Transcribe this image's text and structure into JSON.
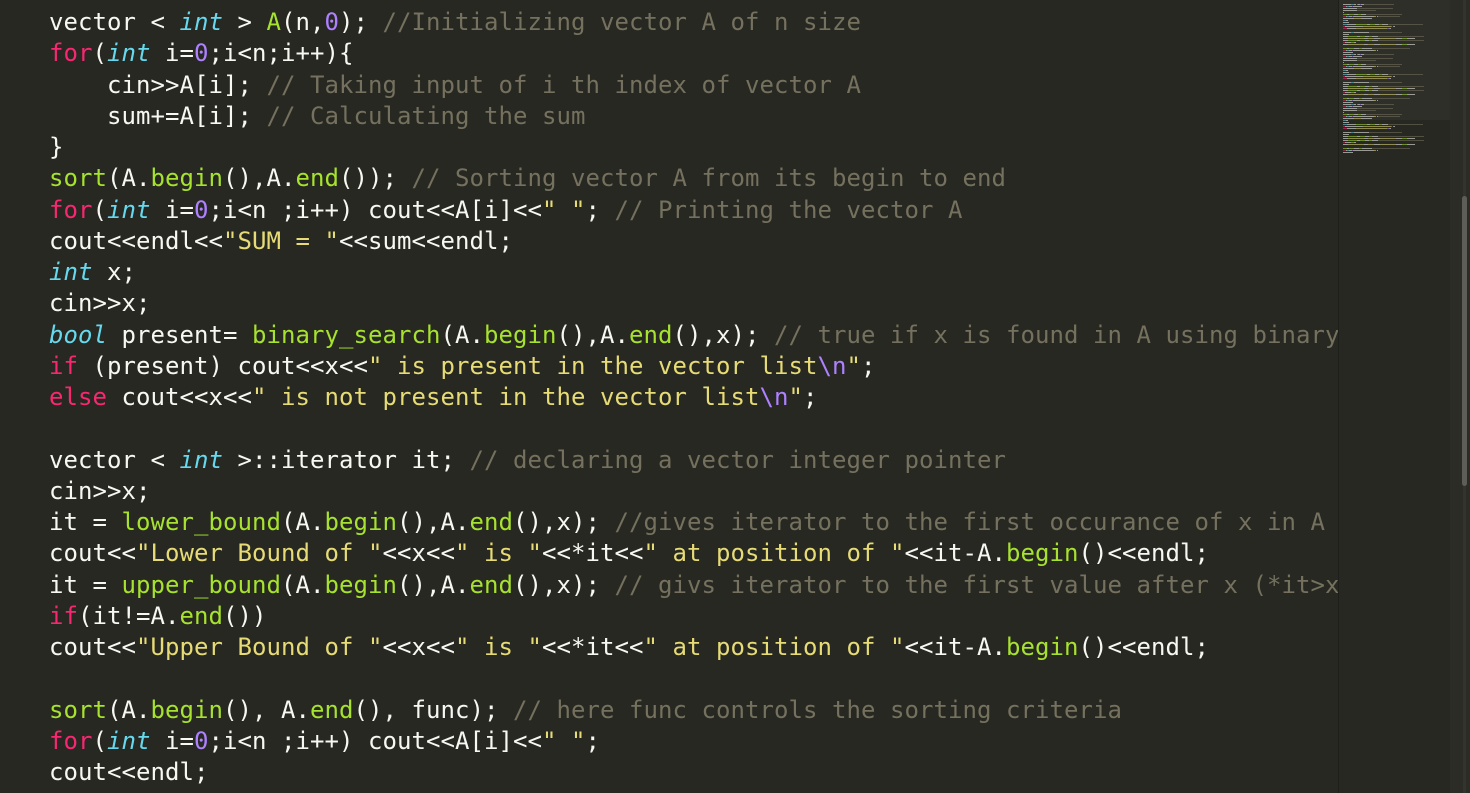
{
  "editor": {
    "colors": {
      "background": "#272822",
      "keyword": "#F92672",
      "type": "#66D9EF",
      "function": "#A6E22E",
      "string": "#E6DB74",
      "number": "#AE81FF",
      "comment": "#75715E",
      "plain": "#F8F8F2"
    },
    "lines": [
      [
        [
          "plain",
          "vector < "
        ],
        [
          "type",
          "int"
        ],
        [
          "plain",
          " > "
        ],
        [
          "fn",
          "A"
        ],
        [
          "plain",
          "(n,"
        ],
        [
          "num",
          "0"
        ],
        [
          "plain",
          "); "
        ],
        [
          "cmt",
          "//Initializing vector A of n size"
        ]
      ],
      [
        [
          "kw",
          "for"
        ],
        [
          "plain",
          "("
        ],
        [
          "type",
          "int"
        ],
        [
          "plain",
          " i="
        ],
        [
          "num",
          "0"
        ],
        [
          "plain",
          ";i<n;i++){"
        ]
      ],
      [
        [
          "plain",
          "    cin>>A[i]; "
        ],
        [
          "cmt",
          "// Taking input of i th index of vector A"
        ]
      ],
      [
        [
          "plain",
          "    sum+=A[i]; "
        ],
        [
          "cmt",
          "// Calculating the sum"
        ]
      ],
      [
        [
          "plain",
          "}"
        ]
      ],
      [
        [
          "fn",
          "sort"
        ],
        [
          "plain",
          "(A."
        ],
        [
          "fn",
          "begin"
        ],
        [
          "plain",
          "(),A."
        ],
        [
          "fn",
          "end"
        ],
        [
          "plain",
          "()); "
        ],
        [
          "cmt",
          "// Sorting vector A from its begin to end"
        ]
      ],
      [
        [
          "kw",
          "for"
        ],
        [
          "plain",
          "("
        ],
        [
          "type",
          "int"
        ],
        [
          "plain",
          " i="
        ],
        [
          "num",
          "0"
        ],
        [
          "plain",
          ";i<n ;i++) cout<<A[i]<<"
        ],
        [
          "str",
          "\" \""
        ],
        [
          "plain",
          "; "
        ],
        [
          "cmt",
          "// Printing the vector A"
        ]
      ],
      [
        [
          "plain",
          "cout<<endl<<"
        ],
        [
          "str",
          "\"SUM = \""
        ],
        [
          "plain",
          "<<sum<<endl;"
        ]
      ],
      [
        [
          "type",
          "int"
        ],
        [
          "plain",
          " x;"
        ]
      ],
      [
        [
          "plain",
          "cin>>x;"
        ]
      ],
      [
        [
          "type",
          "bool"
        ],
        [
          "plain",
          " present= "
        ],
        [
          "fn",
          "binary_search"
        ],
        [
          "plain",
          "(A."
        ],
        [
          "fn",
          "begin"
        ],
        [
          "plain",
          "(),A."
        ],
        [
          "fn",
          "end"
        ],
        [
          "plain",
          "(),x); "
        ],
        [
          "cmt",
          "// true if x is found in A using binary"
        ]
      ],
      [
        [
          "kw",
          "if"
        ],
        [
          "plain",
          " (present) cout<<x<<"
        ],
        [
          "str",
          "\" is present in the vector list"
        ],
        [
          "esc",
          "\\n"
        ],
        [
          "str",
          "\""
        ],
        [
          "plain",
          ";"
        ]
      ],
      [
        [
          "kw",
          "else"
        ],
        [
          "plain",
          " cout<<x<<"
        ],
        [
          "str",
          "\" is not present in the vector list"
        ],
        [
          "esc",
          "\\n"
        ],
        [
          "str",
          "\""
        ],
        [
          "plain",
          ";"
        ]
      ],
      [],
      [
        [
          "plain",
          "vector < "
        ],
        [
          "type",
          "int"
        ],
        [
          "plain",
          " >::iterator it; "
        ],
        [
          "cmt",
          "// declaring a vector integer pointer"
        ]
      ],
      [
        [
          "plain",
          "cin>>x;"
        ]
      ],
      [
        [
          "plain",
          "it = "
        ],
        [
          "fn",
          "lower_bound"
        ],
        [
          "plain",
          "(A."
        ],
        [
          "fn",
          "begin"
        ],
        [
          "plain",
          "(),A."
        ],
        [
          "fn",
          "end"
        ],
        [
          "plain",
          "(),x); "
        ],
        [
          "cmt",
          "//gives iterator to the first occurance of x in A ("
        ]
      ],
      [
        [
          "plain",
          "cout<<"
        ],
        [
          "str",
          "\"Lower Bound of \""
        ],
        [
          "plain",
          "<<x<<"
        ],
        [
          "str",
          "\" is \""
        ],
        [
          "plain",
          "<<*it<<"
        ],
        [
          "str",
          "\" at position of \""
        ],
        [
          "plain",
          "<<it-A."
        ],
        [
          "fn",
          "begin"
        ],
        [
          "plain",
          "()<<endl;"
        ]
      ],
      [
        [
          "plain",
          "it = "
        ],
        [
          "fn",
          "upper_bound"
        ],
        [
          "plain",
          "(A."
        ],
        [
          "fn",
          "begin"
        ],
        [
          "plain",
          "(),A."
        ],
        [
          "fn",
          "end"
        ],
        [
          "plain",
          "(),x); "
        ],
        [
          "cmt",
          "// givs iterator to the first value after x (*it>x)"
        ]
      ],
      [
        [
          "kw",
          "if"
        ],
        [
          "plain",
          "(it!=A."
        ],
        [
          "fn",
          "end"
        ],
        [
          "plain",
          "())"
        ]
      ],
      [
        [
          "plain",
          "cout<<"
        ],
        [
          "str",
          "\"Upper Bound of \""
        ],
        [
          "plain",
          "<<x<<"
        ],
        [
          "str",
          "\" is \""
        ],
        [
          "plain",
          "<<*it<<"
        ],
        [
          "str",
          "\" at position of \""
        ],
        [
          "plain",
          "<<it-A."
        ],
        [
          "fn",
          "begin"
        ],
        [
          "plain",
          "()<<endl;"
        ]
      ],
      [],
      [
        [
          "fn",
          "sort"
        ],
        [
          "plain",
          "(A."
        ],
        [
          "fn",
          "begin"
        ],
        [
          "plain",
          "(), A."
        ],
        [
          "fn",
          "end"
        ],
        [
          "plain",
          "(), func); "
        ],
        [
          "cmt",
          "// here func controls the sorting criteria"
        ]
      ],
      [
        [
          "kw",
          "for"
        ],
        [
          "plain",
          "("
        ],
        [
          "type",
          "int"
        ],
        [
          "plain",
          " i="
        ],
        [
          "num",
          "0"
        ],
        [
          "plain",
          ";i<n ;i++) cout<<A[i]<<"
        ],
        [
          "str",
          "\" \""
        ],
        [
          "plain",
          ";"
        ]
      ],
      [
        [
          "plain",
          "cout<<endl;"
        ]
      ]
    ]
  },
  "scrollbar": {
    "thumb_position_fraction": 0.25
  }
}
